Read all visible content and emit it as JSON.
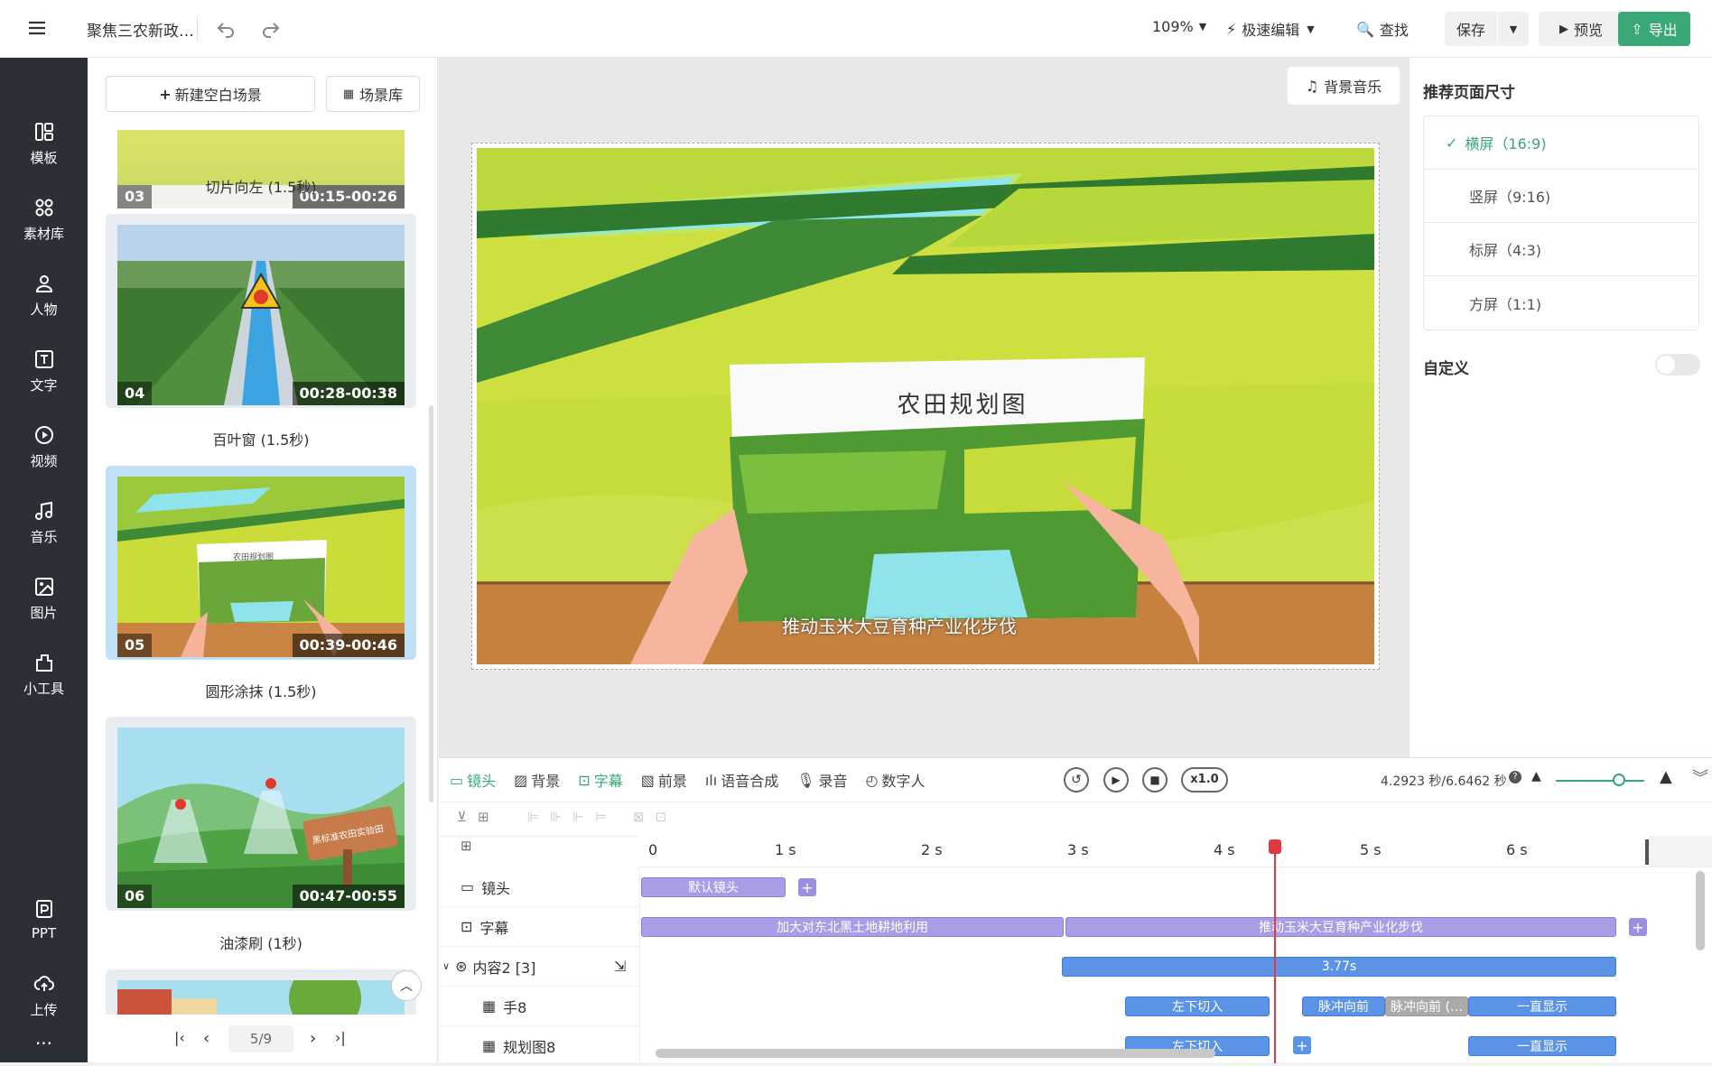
{
  "topbar": {
    "title": "聚焦三农新政…",
    "zoom": "109%",
    "mode": "极速编辑",
    "find": "查找",
    "save": "保存",
    "preview": "预览",
    "export": "导出"
  },
  "leftnav": {
    "items": [
      {
        "label": "模板",
        "icon": "template-icon"
      },
      {
        "label": "素材库",
        "icon": "assets-icon"
      },
      {
        "label": "人物",
        "icon": "person-icon"
      },
      {
        "label": "文字",
        "icon": "text-icon"
      },
      {
        "label": "视频",
        "icon": "video-icon"
      },
      {
        "label": "音乐",
        "icon": "music-icon"
      },
      {
        "label": "图片",
        "icon": "image-icon"
      },
      {
        "label": "小工具",
        "icon": "tools-icon"
      }
    ],
    "bottom": [
      {
        "label": "PPT",
        "icon": "ppt-icon"
      },
      {
        "label": "上传",
        "icon": "upload-icon"
      }
    ],
    "more": "···"
  },
  "scenes": {
    "new_blank": "新建空白场景",
    "library": "场景库",
    "items": [
      {
        "num": "03",
        "time": "00:15-00:26",
        "label": "切片向左 (1.5秒)"
      },
      {
        "num": "04",
        "time": "00:28-00:38",
        "label": "百叶窗 (1.5秒)"
      },
      {
        "num": "05",
        "time": "00:39-00:46",
        "label": "圆形涂抹 (1.5秒)",
        "thumb_text": "农田规划图"
      },
      {
        "num": "06",
        "time": "00:47-00:55",
        "label": "油漆刷 (1秒)",
        "thumb_text": "黑标准农田实验田"
      }
    ],
    "pager": "5/9"
  },
  "canvas": {
    "bg_music": "背景音乐",
    "sign_text": "农田规划图",
    "subtitle": "推动玉米大豆育种产业化步伐"
  },
  "rightpanel": {
    "title": "推荐页面尺寸",
    "sizes": [
      {
        "label": "横屏（16:9)",
        "selected": true
      },
      {
        "label": "竖屏（9:16)",
        "selected": false
      },
      {
        "label": "标屏（4:3)",
        "selected": false
      },
      {
        "label": "方屏（1:1)",
        "selected": false
      }
    ],
    "custom": "自定义",
    "custom_enabled": false
  },
  "timeline": {
    "tabs": [
      "镜头",
      "背景",
      "字幕",
      "前景",
      "语音合成",
      "录音",
      "数字人"
    ],
    "speed": "x1.0",
    "time": "4.2923 秒/6.6462 秒",
    "ticks": [
      "0",
      "1 s",
      "2 s",
      "3 s",
      "4 s",
      "5 s",
      "6 s"
    ],
    "tracks": [
      {
        "label": "镜头",
        "icon": "camera-icon"
      },
      {
        "label": "字幕",
        "icon": "subtitle-icon"
      },
      {
        "label": "内容2 [3]",
        "icon": "content-icon"
      },
      {
        "label": "手8",
        "icon": "image-icon"
      },
      {
        "label": "规划图8",
        "icon": "image-icon"
      }
    ],
    "clips": {
      "camera": "默认镜头",
      "sub1": "加大对东北黑土地耕地利用",
      "sub2": "推动玉米大豆育种产业化步伐",
      "content": "3.77s",
      "hand": [
        "左下切入",
        "脉冲向前",
        "脉冲向前 (…",
        "一直显示"
      ],
      "plan": [
        "左下切入",
        "一直显示"
      ]
    }
  },
  "colors": {
    "accent": "#3aa776",
    "brand_dark": "#2b2f36",
    "clip_purple": "#a89ee6",
    "clip_blue": "#5b93e6",
    "playhead": "#e0393e"
  }
}
